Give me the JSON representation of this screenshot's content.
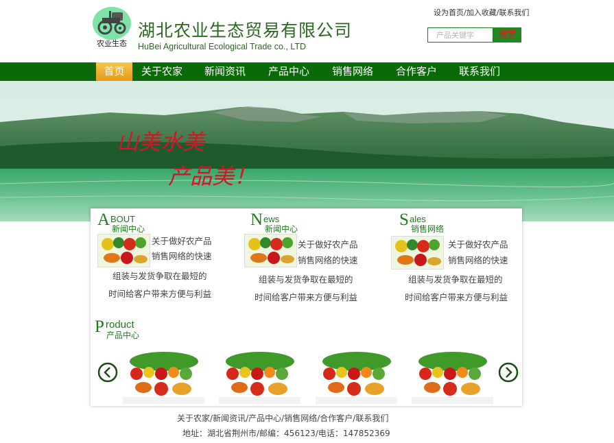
{
  "header": {
    "logo_caption": "农业生态",
    "company_cn": "湖北农业生态贸易有限公司",
    "company_en": "HuBei Agricultural Ecological Trade co., LTD",
    "top_links": [
      "设为首页",
      "加入收藏",
      "联系我们"
    ],
    "top_links_sep": "/",
    "search_placeholder": "产品关键字",
    "search_button": "搜索"
  },
  "nav": {
    "items": [
      "首页",
      "关于农家",
      "新闻资讯",
      "产品中心",
      "销售网络",
      "合作客户",
      "联系我们"
    ],
    "active_index": 0,
    "active_color": "#f0b030",
    "bar_color": "#0b6a08"
  },
  "banner": {
    "slogan_line1": "山美水美",
    "slogan_line2": "产品美！"
  },
  "sections": [
    {
      "letter": "A",
      "rest": "BOUT",
      "cn": "新闻中心",
      "lines": [
        "关于做好农产品",
        "销售网络的快速",
        "组装与发货争取在最短的",
        "时间给客户带来方便与利益"
      ]
    },
    {
      "letter": "N",
      "rest": "ews",
      "cn": "新闻中心",
      "lines": [
        "关于做好农产品",
        "销售网络的快速",
        "组装与发货争取在最短的",
        "时间给客户带来方便与利益"
      ]
    },
    {
      "letter": "S",
      "rest": "ales",
      "cn": "销售网络",
      "lines": [
        "关于做好农产品",
        "销售网络的快速",
        "组装与发货争取在最短的",
        "时间给客户带来方便与利益"
      ]
    }
  ],
  "product": {
    "letter": "P",
    "rest": "roduct",
    "cn": "产品中心",
    "item_count_shown": 4
  },
  "footer": {
    "links": [
      "关于农家",
      "新闻资讯",
      "产品中心",
      "销售网络",
      "合作客户",
      "联系我们"
    ],
    "links_sep": "/",
    "address_text": "地址：湖北省荆州市/邮编：456123/电话：147852369"
  },
  "colors": {
    "brand_green": "#0b6a08",
    "title_green": "#2a6a1e",
    "search_text_red": "#d32020"
  }
}
